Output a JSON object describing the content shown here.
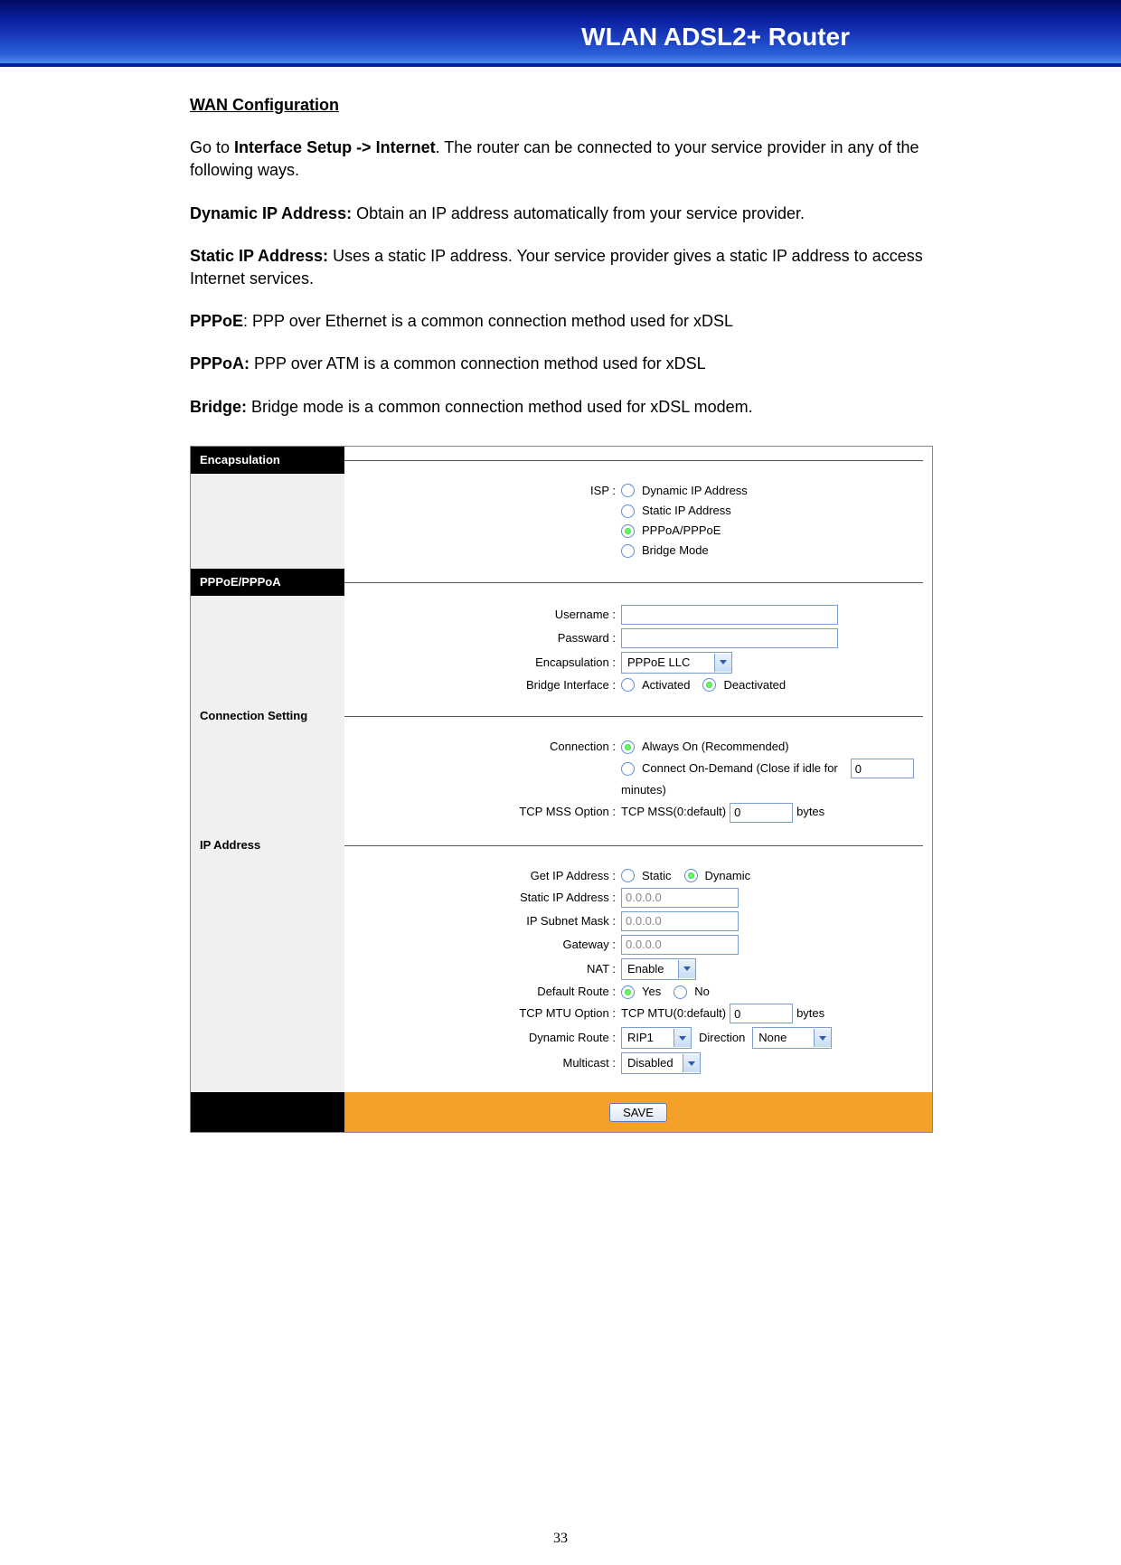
{
  "header": {
    "title": "WLAN ADSL2+ Router"
  },
  "doc": {
    "section_title": "WAN Configuration",
    "intro_prefix": "Go to ",
    "intro_bold": "Interface Setup -> Internet",
    "intro_suffix": ". The router can be connected to your service provider in any of the following ways.",
    "dyn_label": "Dynamic IP Address:",
    "dyn_text": " Obtain an IP address automatically from your service provider.",
    "static_label": "Static IP Address:",
    "static_text": " Uses a static IP address. Your service provider gives a static IP address to access Internet services.",
    "pppoe_label": "PPPoE",
    "pppoe_text": ": PPP over Ethernet is a common connection method used for xDSL",
    "pppoa_label": "PPPoA:",
    "pppoa_text": " PPP over ATM is a common connection method used for xDSL",
    "bridge_label": "Bridge:",
    "bridge_text": " Bridge mode is a common connection method used for xDSL modem."
  },
  "panel": {
    "encapsulation_header": "Encapsulation",
    "pppoe_header": "PPPoE/PPPoA",
    "connection_setting_header": "Connection Setting",
    "ip_address_header": "IP Address",
    "isp_label": "ISP :",
    "isp_options": {
      "dynamic": "Dynamic IP Address",
      "static": "Static IP Address",
      "pppoa": "PPPoA/PPPoE",
      "bridge": "Bridge Mode"
    },
    "username_label": "Username :",
    "password_label": "Passward :",
    "encapsulation_label": "Encapsulation :",
    "encapsulation_value": "PPPoE LLC",
    "bridge_interface_label": "Bridge Interface :",
    "bridge_activated": "Activated",
    "bridge_deactivated": "Deactivated",
    "connection_label": "Connection :",
    "connection_always": "Always On (Recommended)",
    "connection_ondemand_pre": "Connect On-Demand (Close if idle for",
    "connection_ondemand_value": "0",
    "connection_ondemand_post": "minutes)",
    "tcp_mss_label": "TCP MSS Option :",
    "tcp_mss_pre": "TCP MSS(0:default)",
    "tcp_mss_value": "0",
    "tcp_mss_post": "bytes",
    "get_ip_label": "Get IP Address :",
    "get_ip_static": "Static",
    "get_ip_dynamic": "Dynamic",
    "static_ip_label": "Static IP Address :",
    "static_ip_value": "0.0.0.0",
    "subnet_label": "IP Subnet Mask :",
    "subnet_value": "0.0.0.0",
    "gateway_label": "Gateway :",
    "gateway_value": "0.0.0.0",
    "nat_label": "NAT :",
    "nat_value": "Enable",
    "default_route_label": "Default Route :",
    "default_route_yes": "Yes",
    "default_route_no": "No",
    "tcp_mtu_label": "TCP MTU Option :",
    "tcp_mtu_pre": "TCP MTU(0:default)",
    "tcp_mtu_value": "0",
    "tcp_mtu_post": "bytes",
    "dynamic_route_label": "Dynamic Route :",
    "dynamic_route_value": "RIP1",
    "direction_label": "Direction",
    "direction_value": "None",
    "multicast_label": "Multicast :",
    "multicast_value": "Disabled",
    "save_button": "SAVE"
  },
  "page_number": "33"
}
